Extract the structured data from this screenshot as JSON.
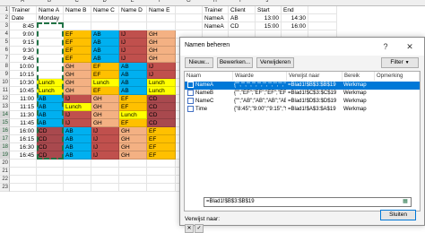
{
  "sheet": {
    "col_headers": [
      "A",
      "B",
      "C",
      "D",
      "E",
      "F",
      "G",
      "H",
      "I",
      "J"
    ],
    "row_numbers": [
      "1",
      "2",
      "3",
      "4",
      "5",
      "6",
      "7",
      "8",
      "9",
      "10",
      "11",
      "12",
      "13",
      "14",
      "15",
      "16",
      "17",
      "18",
      "19",
      "20",
      "21",
      "22",
      "23"
    ],
    "trainers": {
      "header_row": [
        "Trainer",
        "Name A",
        "Name B",
        "Name C",
        "Name D",
        "Name E"
      ],
      "date_row": [
        "Date",
        "Monday",
        "",
        "",
        "",
        ""
      ],
      "rows": [
        {
          "time": "8:45",
          "b": "",
          "c": "",
          "d": "",
          "e": "",
          "f": ""
        },
        {
          "time": "9:00",
          "b": "",
          "c": "EF",
          "d": "AB",
          "e": "IJ",
          "f": "GH"
        },
        {
          "time": "9:15",
          "b": "",
          "c": "EF",
          "d": "AB",
          "e": "IJ",
          "f": "GH"
        },
        {
          "time": "9:30",
          "b": "",
          "c": "EF",
          "d": "AB",
          "e": "IJ",
          "f": "GH"
        },
        {
          "time": "9:45",
          "b": "",
          "c": "EF",
          "d": "AB",
          "e": "IJ",
          "f": "GH"
        },
        {
          "time": "10:00",
          "b": "",
          "c": "GH",
          "d": "EF",
          "e": "AB",
          "f": "IJ"
        },
        {
          "time": "10:15",
          "b": "",
          "c": "GH",
          "d": "EF",
          "e": "AB",
          "f": "IJ"
        },
        {
          "time": "10:30",
          "b": "Lunch",
          "c": "GH",
          "d": "Lunch",
          "e": "AB",
          "f": "Lunch"
        },
        {
          "time": "10:45",
          "b": "Lunch",
          "c": "GH",
          "d": "EF",
          "e": "AB",
          "f": "Lunch"
        },
        {
          "time": "11:00",
          "b": "AB",
          "c": "IJ",
          "d": "GH",
          "e": "EF",
          "f": "CD"
        },
        {
          "time": "11:15",
          "b": "AB",
          "c": "Lunch",
          "d": "GH",
          "e": "EF",
          "f": "CD"
        },
        {
          "time": "11:30",
          "b": "AB",
          "c": "IJ",
          "d": "GH",
          "e": "Lunch",
          "f": "CD"
        },
        {
          "time": "11:45",
          "b": "AB",
          "c": "IJ",
          "d": "GH",
          "e": "EF",
          "f": "CD"
        },
        {
          "time": "16:00",
          "b": "CD",
          "c": "AB",
          "d": "IJ",
          "e": "GH",
          "f": "EF"
        },
        {
          "time": "16:15",
          "b": "CD",
          "c": "AB",
          "d": "IJ",
          "e": "GH",
          "f": "EF"
        },
        {
          "time": "16:30",
          "b": "CD",
          "c": "AB",
          "d": "IJ",
          "e": "GH",
          "f": "EF"
        },
        {
          "time": "16:45",
          "b": "CD",
          "c": "AB",
          "d": "IJ",
          "e": "GH",
          "f": "EF"
        }
      ]
    },
    "client_table": {
      "headers": [
        "Trainer",
        "Client",
        "Start",
        "End"
      ],
      "rows": [
        [
          "NameA",
          "AB",
          "13:00",
          "14:30"
        ],
        [
          "NameA",
          "CD",
          "15:00",
          "16:00"
        ]
      ]
    },
    "colors": {
      "AB": "#00b0f0",
      "CD": "#a9494e",
      "EF": "#ffc000",
      "GH": "#f4b183",
      "IJ": "#c0504d",
      "Lunch": "#ffff00",
      "selection": "#217346"
    }
  },
  "dialog": {
    "title": "Namen beheren",
    "btn_new": "Nieuw...",
    "btn_edit": "Bewerken...",
    "btn_delete": "Verwijderen",
    "btn_filter": "Filter",
    "columns": [
      "Naam",
      "Waarde",
      "Verwijst naar",
      "Bereik",
      "Opmerking"
    ],
    "names": [
      {
        "name": "NameA",
        "value": "{\"\",\"\",\"\",\"\",\"\",\"\",\"\",\"\",\"\",\"\",\"\",\"\",\"\",\"\",\"\",\"",
        "ref": "=Blad1!$B$3:$B$19",
        "scope": "Werkmap",
        "comment": ""
      },
      {
        "name": "NameB",
        "value": "{\"\";\"EF\";\"EF\";\"EF\";\"EF\";\"G...",
        "ref": "=Blad1!$C$3:$C$19",
        "scope": "Werkmap",
        "comment": ""
      },
      {
        "name": "NameC",
        "value": "{\"\";\"AB\";\"AB\";\"AB\";\"AB\";\"EF...",
        "ref": "=Blad1!$D$3:$D$19",
        "scope": "Werkmap",
        "comment": ""
      },
      {
        "name": "Time",
        "value": "{\"8:45\";\"9:00\";\"9:15\";\"9:30\"...",
        "ref": "=Blad1!$A$3:$A$19",
        "scope": "Werkmap",
        "comment": ""
      }
    ],
    "ref_label": "Verwijst naar:",
    "ref_value": "=Blad1!$B$3:$B$19",
    "close": "Sluiten"
  }
}
